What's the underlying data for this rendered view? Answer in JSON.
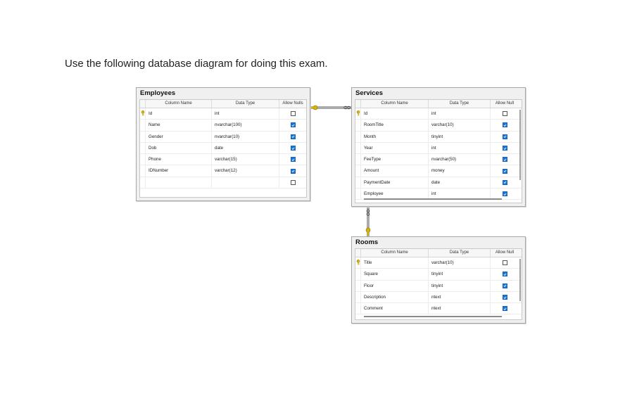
{
  "instruction": "Use the following database diagram for doing this exam.",
  "headers": {
    "column_name": "Column Name",
    "data_type": "Data Type"
  },
  "tables": {
    "employees": {
      "title": "Employees",
      "allow_nulls_label": "Allow Nulls",
      "rows": [
        {
          "name": "Id",
          "type": "int",
          "nullable": false,
          "pk": true
        },
        {
          "name": "Name",
          "type": "nvarchar(100)",
          "nullable": true,
          "pk": false
        },
        {
          "name": "Gender",
          "type": "nvarchar(10)",
          "nullable": true,
          "pk": false
        },
        {
          "name": "Dob",
          "type": "date",
          "nullable": true,
          "pk": false
        },
        {
          "name": "Phone",
          "type": "varchar(15)",
          "nullable": true,
          "pk": false
        },
        {
          "name": "IDNumber",
          "type": "varchar(12)",
          "nullable": true,
          "pk": false
        },
        {
          "name": "",
          "type": "",
          "nullable": false,
          "pk": false
        }
      ]
    },
    "services": {
      "title": "Services",
      "allow_nulls_label": "Allow Null",
      "rows": [
        {
          "name": "Id",
          "type": "int",
          "nullable": false,
          "pk": true
        },
        {
          "name": "RoomTitle",
          "type": "varchar(10)",
          "nullable": true,
          "pk": false
        },
        {
          "name": "Month",
          "type": "tinyint",
          "nullable": true,
          "pk": false
        },
        {
          "name": "Year",
          "type": "int",
          "nullable": true,
          "pk": false
        },
        {
          "name": "FeeType",
          "type": "nvarchar(50)",
          "nullable": true,
          "pk": false
        },
        {
          "name": "Amount",
          "type": "money",
          "nullable": true,
          "pk": false
        },
        {
          "name": "PaymentDate",
          "type": "date",
          "nullable": true,
          "pk": false
        },
        {
          "name": "Employee",
          "type": "int",
          "nullable": true,
          "pk": false
        }
      ]
    },
    "rooms": {
      "title": "Rooms",
      "allow_nulls_label": "Allow Null",
      "rows": [
        {
          "name": "Title",
          "type": "varchar(10)",
          "nullable": false,
          "pk": true
        },
        {
          "name": "Square",
          "type": "tinyint",
          "nullable": true,
          "pk": false
        },
        {
          "name": "Floor",
          "type": "tinyint",
          "nullable": true,
          "pk": false
        },
        {
          "name": "Description",
          "type": "ntext",
          "nullable": true,
          "pk": false
        },
        {
          "name": "Comment",
          "type": "ntext",
          "nullable": true,
          "pk": false
        }
      ]
    }
  }
}
